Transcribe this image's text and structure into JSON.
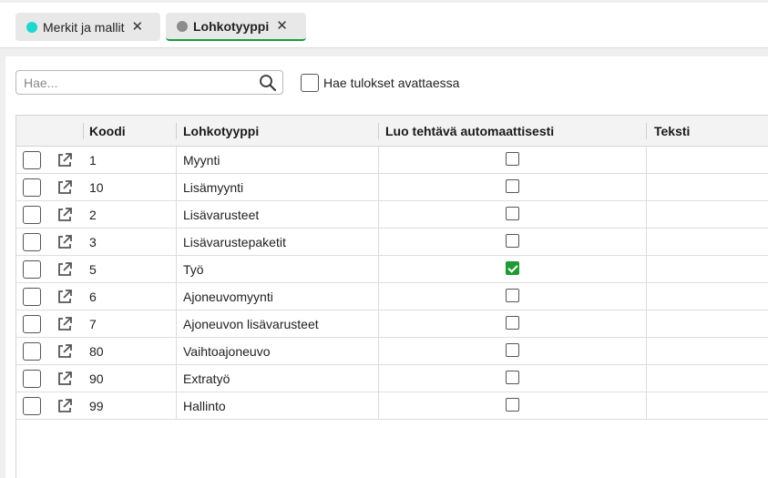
{
  "tabs": [
    {
      "label": "Merkit ja mallit",
      "dot_color": "#1cd6d0",
      "active": false
    },
    {
      "label": "Lohkotyyppi",
      "dot_color": "#8c8c8c",
      "active": true
    }
  ],
  "search": {
    "placeholder": "Hae...",
    "value": ""
  },
  "open_on_load": {
    "label": "Hae tulokset avattaessa",
    "checked": false
  },
  "table": {
    "columns": [
      "Koodi",
      "Lohkotyyppi",
      "Luo tehtävä automaattisesti",
      "Teksti"
    ],
    "rows": [
      {
        "code": "1",
        "name": "Myynti",
        "auto": false,
        "text": ""
      },
      {
        "code": "10",
        "name": "Lisämyynti",
        "auto": false,
        "text": ""
      },
      {
        "code": "2",
        "name": "Lisävarusteet",
        "auto": false,
        "text": ""
      },
      {
        "code": "3",
        "name": "Lisävarustepaketit",
        "auto": false,
        "text": ""
      },
      {
        "code": "5",
        "name": "Työ",
        "auto": true,
        "text": ""
      },
      {
        "code": "6",
        "name": "Ajoneuvomyynti",
        "auto": false,
        "text": ""
      },
      {
        "code": "7",
        "name": "Ajoneuvon lisävarusteet",
        "auto": false,
        "text": ""
      },
      {
        "code": "80",
        "name": "Vaihtoajoneuvo",
        "auto": false,
        "text": ""
      },
      {
        "code": "90",
        "name": "Extratyö",
        "auto": false,
        "text": ""
      },
      {
        "code": "99",
        "name": "Hallinto",
        "auto": false,
        "text": ""
      }
    ]
  },
  "colors": {
    "accent_green": "#1e9b33",
    "tab_underline": "#1a9c3e"
  }
}
